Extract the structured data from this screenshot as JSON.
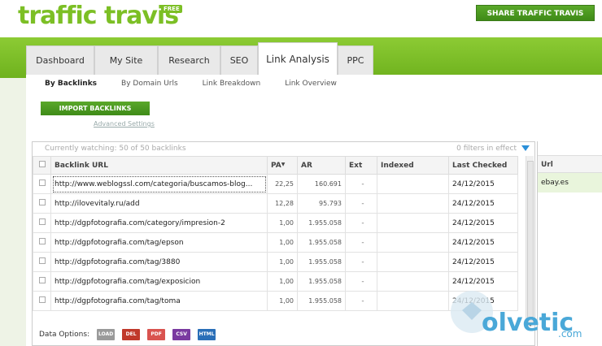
{
  "app": {
    "logo_text": "traffic travis",
    "free_badge": "FREE",
    "share_button": "SHARE TRAFFIC TRAVIS"
  },
  "tabs": [
    {
      "label": "Dashboard",
      "active": false
    },
    {
      "label": "My Site",
      "active": false
    },
    {
      "label": "Research",
      "active": false
    },
    {
      "label": "SEO",
      "active": false
    },
    {
      "label": "Link Analysis",
      "active": true
    },
    {
      "label": "PPC",
      "active": false
    }
  ],
  "subtabs": [
    {
      "label": "By Backlinks",
      "active": true
    },
    {
      "label": "By Domain Urls",
      "active": false
    },
    {
      "label": "Link Breakdown",
      "active": false
    },
    {
      "label": "Link Overview",
      "active": false
    }
  ],
  "import_button": "IMPORT BACKLINKS",
  "advanced_settings": "Advanced Settings",
  "table": {
    "watching": "Currently watching: 50 of 50 backlinks",
    "filters": "0 filters in effect",
    "columns": [
      "Backlink URL",
      "PA",
      "AR",
      "Ext",
      "Indexed",
      "Last Checked"
    ],
    "rows": [
      {
        "url": "http://www.weblogssl.com/categoria/buscamos-blog...",
        "pa": "22,25",
        "ar": "160.691",
        "ext": "-",
        "indexed": "",
        "last_checked": "24/12/2015"
      },
      {
        "url": "http://ilovevitaly.ru/add",
        "pa": "12,28",
        "ar": "95.793",
        "ext": "-",
        "indexed": "",
        "last_checked": "24/12/2015"
      },
      {
        "url": "http://dgpfotografia.com/category/impresion-2",
        "pa": "1,00",
        "ar": "1.955.058",
        "ext": "-",
        "indexed": "",
        "last_checked": "24/12/2015"
      },
      {
        "url": "http://dgpfotografia.com/tag/epson",
        "pa": "1,00",
        "ar": "1.955.058",
        "ext": "-",
        "indexed": "",
        "last_checked": "24/12/2015"
      },
      {
        "url": "http://dgpfotografia.com/tag/3880",
        "pa": "1,00",
        "ar": "1.955.058",
        "ext": "-",
        "indexed": "",
        "last_checked": "24/12/2015"
      },
      {
        "url": "http://dgpfotografia.com/tag/exposicion",
        "pa": "1,00",
        "ar": "1.955.058",
        "ext": "-",
        "indexed": "",
        "last_checked": "24/12/2015"
      },
      {
        "url": "http://dgpfotografia.com/tag/toma",
        "pa": "1,00",
        "ar": "1.955.058",
        "ext": "-",
        "indexed": "",
        "last_checked": "24/12/2015"
      }
    ]
  },
  "data_options": {
    "label": "Data Options:",
    "items": [
      {
        "label": "LOAD",
        "color": "#9a9a9a"
      },
      {
        "label": "DEL",
        "color": "#c0392b"
      },
      {
        "label": "PDF",
        "color": "#d9534f"
      },
      {
        "label": "CSV",
        "color": "#7a3aa0"
      },
      {
        "label": "HTML",
        "color": "#2a6fb8"
      }
    ]
  },
  "right_panel": {
    "header": "Url",
    "value": "ebay.es"
  },
  "watermark": {
    "text": "olvetic",
    "suffix": ".com"
  }
}
